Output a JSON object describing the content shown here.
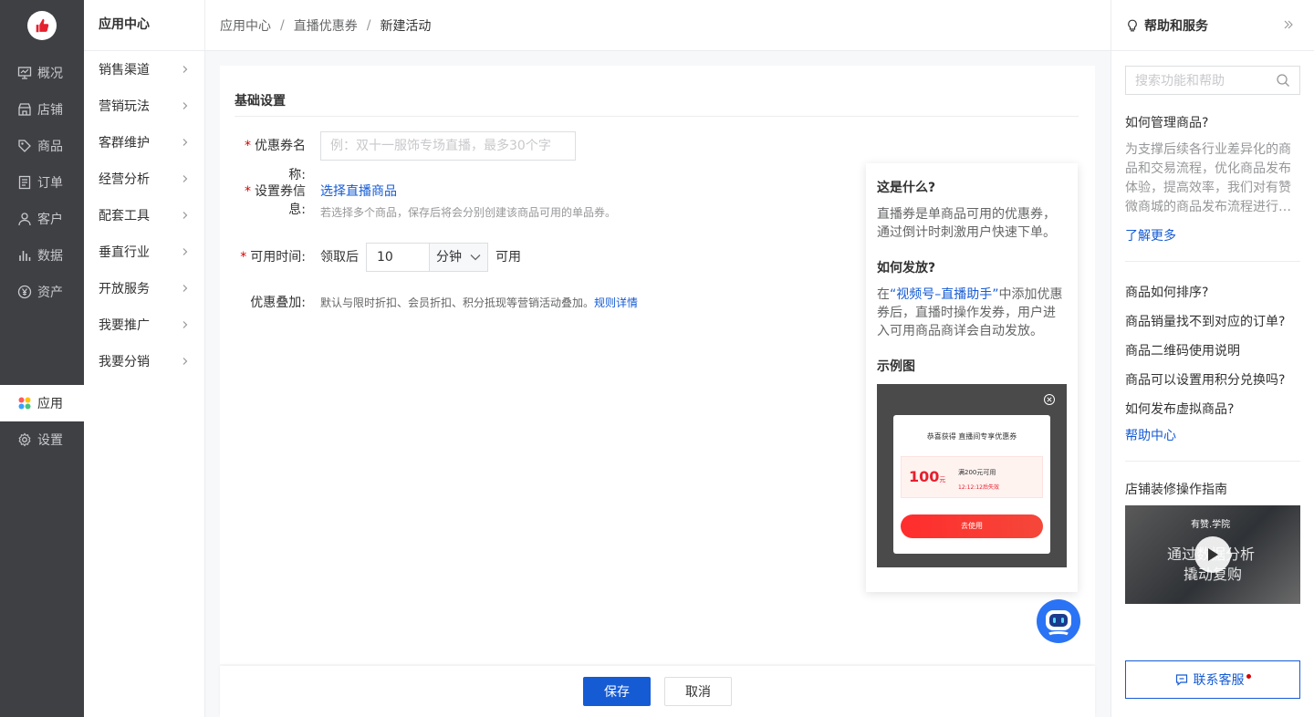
{
  "nav1": {
    "items": [
      {
        "label": "概况",
        "icon": "dashboard-icon"
      },
      {
        "label": "店铺",
        "icon": "store-icon"
      },
      {
        "label": "商品",
        "icon": "tag-icon"
      },
      {
        "label": "订单",
        "icon": "order-icon"
      },
      {
        "label": "客户",
        "icon": "user-icon"
      },
      {
        "label": "数据",
        "icon": "bar-chart-icon"
      },
      {
        "label": "资产",
        "icon": "yen-icon"
      }
    ],
    "app": {
      "label": "应用",
      "icon": "apps-icon"
    },
    "settings": {
      "label": "设置",
      "icon": "gear-icon"
    }
  },
  "nav2": {
    "title": "应用中心",
    "items": [
      "销售渠道",
      "营销玩法",
      "客群维护",
      "经营分析",
      "配套工具",
      "垂直行业",
      "开放服务",
      "我要推广",
      "我要分销"
    ]
  },
  "breadcrumb": {
    "items": [
      "应用中心",
      "直播优惠券",
      "新建活动"
    ],
    "separator": "/"
  },
  "form": {
    "section_title": "基础设置",
    "required_mark": "*",
    "name": {
      "label": "优惠券名称:",
      "placeholder": "例：双十一服饰专场直播，最多30个字"
    },
    "coupon_info": {
      "label": "设置券信息:",
      "link": "选择直播商品",
      "hint": "若选择多个商品，保存后将会分别创建该商品可用的单品券。"
    },
    "time": {
      "label": "可用时间:",
      "prefix": "领取后",
      "value": "10",
      "unit": "分钟",
      "suffix": "可用"
    },
    "stack": {
      "label": "优惠叠加:",
      "note": "默认与限时折扣、会员折扣、积分抵现等营销活动叠加。",
      "link": "规则详情"
    }
  },
  "popover": {
    "q1": "这是什么?",
    "a1": "直播券是单商品可用的优惠券，通过倒计时刺激用户快速下单。",
    "q2": "如何发放?",
    "a2_pre": "在",
    "a2_link": "“视频号–直播助手”",
    "a2_post": "中添加优惠券后，直播时操作发券，用户进入可用商品商详会自动发放。",
    "q3": "示例图",
    "example": {
      "title": "恭喜获得 直播间专享优惠券",
      "amount": "100",
      "amount_unit": "元",
      "condition": "满200元可用",
      "expire": "12:12:12后失效",
      "button": "去使用"
    }
  },
  "footer": {
    "save": "保存",
    "cancel": "取消"
  },
  "help": {
    "title": "帮助和服务",
    "search_placeholder": "搜索功能和帮助",
    "q_manage": "如何管理商品?",
    "q_manage_desc": "为支撑后续各行业差异化的商品和交易流程，优化商品发布体验，提高效率，我们对有赞微商城的商品发布流程进行…",
    "learn_more": "了解更多",
    "list": [
      "商品如何排序?",
      "商品销量找不到对应的订单?",
      "商品二维码使用说明",
      "商品可以设置用积分兑换吗?",
      "如何发布虚拟商品?"
    ],
    "help_center": "帮助中心",
    "guide_title": "店铺装修操作指南",
    "video": {
      "brand": "有赞.学院",
      "line1": "通过数据分析",
      "line2": "撬动复购"
    },
    "contact": "联系客服"
  }
}
